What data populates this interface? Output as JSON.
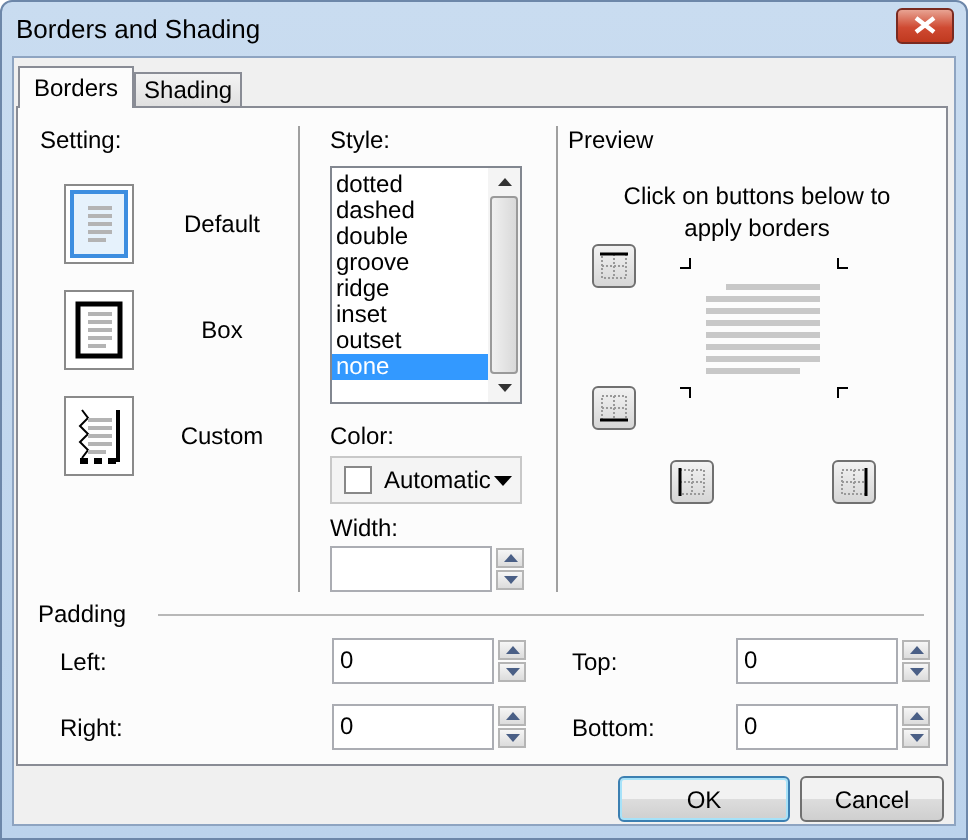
{
  "window": {
    "title": "Borders and Shading"
  },
  "tabs": [
    {
      "label": "Borders",
      "selected": true
    },
    {
      "label": "Shading",
      "selected": false
    }
  ],
  "setting": {
    "label": "Setting:",
    "options": [
      {
        "label": "Default",
        "kind": "default",
        "selected": true
      },
      {
        "label": "Box",
        "kind": "box",
        "selected": false
      },
      {
        "label": "Custom",
        "kind": "custom",
        "selected": false
      }
    ]
  },
  "style": {
    "label": "Style:",
    "items": [
      {
        "label": "dotted",
        "selected": false
      },
      {
        "label": "dashed",
        "selected": false
      },
      {
        "label": "double",
        "selected": false
      },
      {
        "label": "groove",
        "selected": false
      },
      {
        "label": "ridge",
        "selected": false
      },
      {
        "label": "inset",
        "selected": false
      },
      {
        "label": "outset",
        "selected": false
      },
      {
        "label": "none",
        "selected": true
      }
    ]
  },
  "color": {
    "label": "Color:",
    "value": "Automatic"
  },
  "width": {
    "label": "Width:"
  },
  "preview": {
    "label": "Preview",
    "hint": "Click on buttons below to apply borders"
  },
  "padding": {
    "label": "Padding",
    "fields": [
      {
        "label": "Left:",
        "value": "0"
      },
      {
        "label": "Top:",
        "value": "0"
      },
      {
        "label": "Right:",
        "value": "0"
      },
      {
        "label": "Bottom:",
        "value": "0"
      }
    ]
  },
  "buttons": [
    {
      "label": "OK",
      "default": true
    },
    {
      "label": "Cancel",
      "default": false
    }
  ]
}
